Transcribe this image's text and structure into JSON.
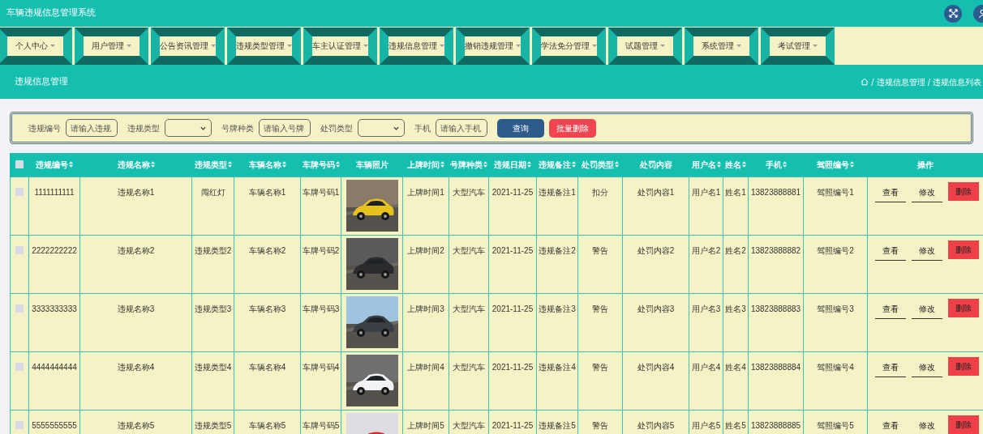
{
  "app_title": "车辆违规信息管理系统",
  "nav": [
    {
      "label": "个人中心"
    },
    {
      "label": "用户管理"
    },
    {
      "label": "公告资讯管理"
    },
    {
      "label": "违规类型管理"
    },
    {
      "label": "车主认证管理"
    },
    {
      "label": "违规信息管理"
    },
    {
      "label": "撤销违规管理"
    },
    {
      "label": "学法免分管理"
    },
    {
      "label": "试题管理"
    },
    {
      "label": "系统管理"
    },
    {
      "label": "考试管理"
    }
  ],
  "page_title": "违规信息管理",
  "breadcrumb_separator": "/",
  "breadcrumb": [
    "违规信息管理",
    "违规信息列表"
  ],
  "search": [
    {
      "kind": "input",
      "label": "违规编号",
      "placeholder": "请输入违规"
    },
    {
      "kind": "select",
      "label": "违规类型"
    },
    {
      "kind": "input",
      "label": "号牌种类",
      "placeholder": "请输入号牌"
    },
    {
      "kind": "select",
      "label": "处罚类型"
    },
    {
      "kind": "input",
      "label": "手机",
      "placeholder": "请输入手机"
    }
  ],
  "search_buttons": [
    {
      "kind": "primary",
      "label": "查询"
    },
    {
      "kind": "danger",
      "label": "批量删除"
    }
  ],
  "table": {
    "select_all_checked": false,
    "columns": [
      {
        "label": "违规编号",
        "sortable": true,
        "kind": "text"
      },
      {
        "label": "违规名称",
        "sortable": true,
        "kind": "text"
      },
      {
        "label": "违规类型",
        "sortable": true,
        "kind": "text"
      },
      {
        "label": "车辆名称",
        "sortable": true,
        "kind": "text"
      },
      {
        "label": "车牌号码",
        "sortable": true,
        "kind": "text"
      },
      {
        "label": "车辆照片",
        "sortable": false,
        "kind": "picture"
      },
      {
        "label": "上牌时间",
        "sortable": true,
        "kind": "text"
      },
      {
        "label": "号牌种类",
        "sortable": true,
        "kind": "text"
      },
      {
        "label": "违规日期",
        "sortable": true,
        "kind": "text"
      },
      {
        "label": "违规备注",
        "sortable": true,
        "kind": "text"
      },
      {
        "label": "处罚类型",
        "sortable": true,
        "kind": "text"
      },
      {
        "label": "处罚内容",
        "sortable": false,
        "kind": "text"
      },
      {
        "label": "用户名",
        "sortable": true,
        "kind": "text"
      },
      {
        "label": "姓名",
        "sortable": true,
        "kind": "text"
      },
      {
        "label": "手机",
        "sortable": true,
        "kind": "text"
      },
      {
        "label": "驾照编号",
        "sortable": true,
        "kind": "text"
      },
      {
        "label": "操作",
        "sortable": false,
        "kind": "actions"
      }
    ],
    "rows": [
      {
        "checked": false,
        "cells": [
          "1111111111",
          "违规名称1",
          "闯红灯",
          "车辆名称1",
          "车牌号码1",
          "",
          "上牌时间1",
          "大型汽车",
          "2021-11-25",
          "违规备注1",
          "扣分",
          "处罚内容1",
          "用户名1",
          "姓名1",
          "13823888881",
          "驾照编号1"
        ],
        "actions": [
          {
            "kind": "link",
            "label": "查看"
          },
          {
            "kind": "link",
            "label": "修改"
          },
          {
            "kind": "danger",
            "label": "删除"
          }
        ]
      },
      {
        "checked": false,
        "cells": [
          "2222222222",
          "违规名称2",
          "违规类型2",
          "车辆名称2",
          "车牌号码2",
          "",
          "上牌时间2",
          "大型汽车",
          "2021-11-25",
          "违规备注2",
          "警告",
          "处罚内容2",
          "用户名2",
          "姓名2",
          "13823888882",
          "驾照编号2"
        ],
        "actions": [
          {
            "kind": "link",
            "label": "查看"
          },
          {
            "kind": "link",
            "label": "修改"
          },
          {
            "kind": "danger",
            "label": "删除"
          }
        ]
      },
      {
        "checked": false,
        "cells": [
          "3333333333",
          "违规名称3",
          "违规类型3",
          "车辆名称3",
          "车牌号码3",
          "",
          "上牌时间3",
          "大型汽车",
          "2021-11-25",
          "违规备注3",
          "警告",
          "处罚内容3",
          "用户名3",
          "姓名3",
          "13823888883",
          "驾照编号3"
        ],
        "actions": [
          {
            "kind": "link",
            "label": "查看"
          },
          {
            "kind": "link",
            "label": "修改"
          },
          {
            "kind": "danger",
            "label": "删除"
          }
        ]
      },
      {
        "checked": false,
        "cells": [
          "4444444444",
          "违规名称4",
          "违规类型4",
          "车辆名称4",
          "车牌号码4",
          "",
          "上牌时间4",
          "大型汽车",
          "2021-11-25",
          "违规备注4",
          "警告",
          "处罚内容4",
          "用户名4",
          "姓名4",
          "13823888884",
          "驾照编号4"
        ],
        "actions": [
          {
            "kind": "link",
            "label": "查看"
          },
          {
            "kind": "link",
            "label": "修改"
          },
          {
            "kind": "danger",
            "label": "删除"
          }
        ]
      },
      {
        "checked": false,
        "cells": [
          "5555555555",
          "违规名称5",
          "违规类型5",
          "车辆名称5",
          "车牌号码5",
          "",
          "上牌时间5",
          "大型汽车",
          "2021-11-25",
          "违规备注5",
          "警告",
          "处罚内容5",
          "用户名5",
          "姓名5",
          "13823888885",
          "驾照编号5"
        ],
        "actions": [
          {
            "kind": "link",
            "label": "查看"
          },
          {
            "kind": "link",
            "label": "修改"
          },
          {
            "kind": "danger",
            "label": "删除"
          }
        ]
      }
    ]
  }
}
